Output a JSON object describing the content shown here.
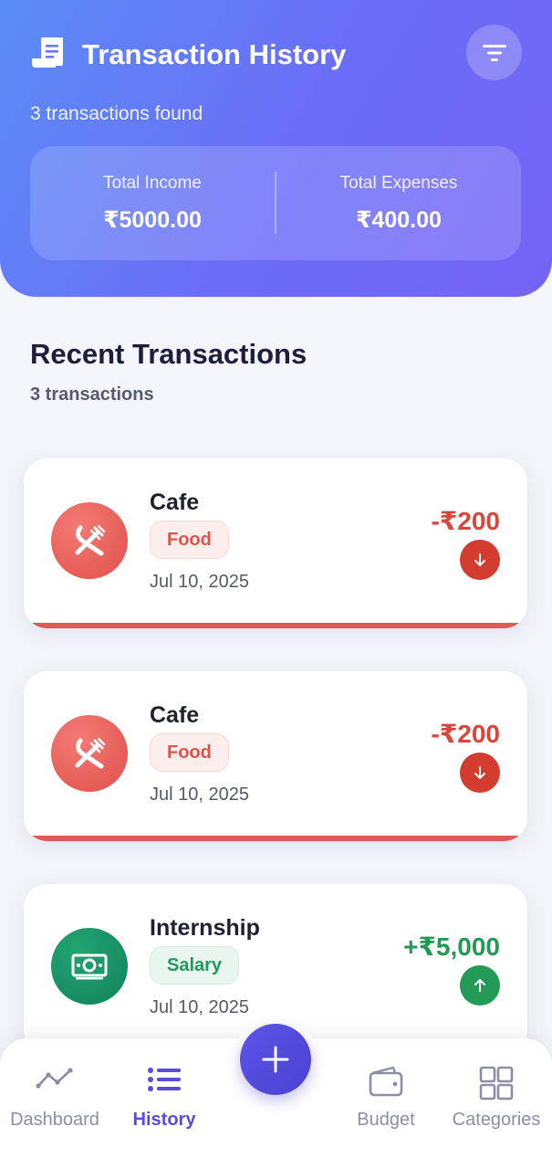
{
  "header": {
    "title": "Transaction History",
    "subtitle": "3 transactions found",
    "summary": {
      "income_label": "Total Income",
      "income_value": "₹5000.00",
      "expenses_label": "Total Expenses",
      "expenses_value": "₹400.00"
    }
  },
  "section": {
    "title": "Recent Transactions",
    "count": "3 transactions"
  },
  "transactions": [
    {
      "name": "Cafe",
      "category": "Food",
      "date": "Jul 10, 2025",
      "amount": "-₹200",
      "direction": "down",
      "icon": "fork-knife-icon"
    },
    {
      "name": "Cafe",
      "category": "Food",
      "date": "Jul 10, 2025",
      "amount": "-₹200",
      "direction": "down",
      "icon": "fork-knife-icon"
    },
    {
      "name": "Internship",
      "category": "Salary",
      "date": "Jul 10, 2025",
      "amount": "+₹5,000",
      "direction": "up",
      "icon": "cash-icon"
    }
  ],
  "nav": {
    "dashboard": "Dashboard",
    "history": "History",
    "budget": "Budget",
    "categories": "Categories"
  },
  "colors": {
    "expense": "#d9463a",
    "income": "#229957",
    "accent": "#5a4bd8"
  }
}
